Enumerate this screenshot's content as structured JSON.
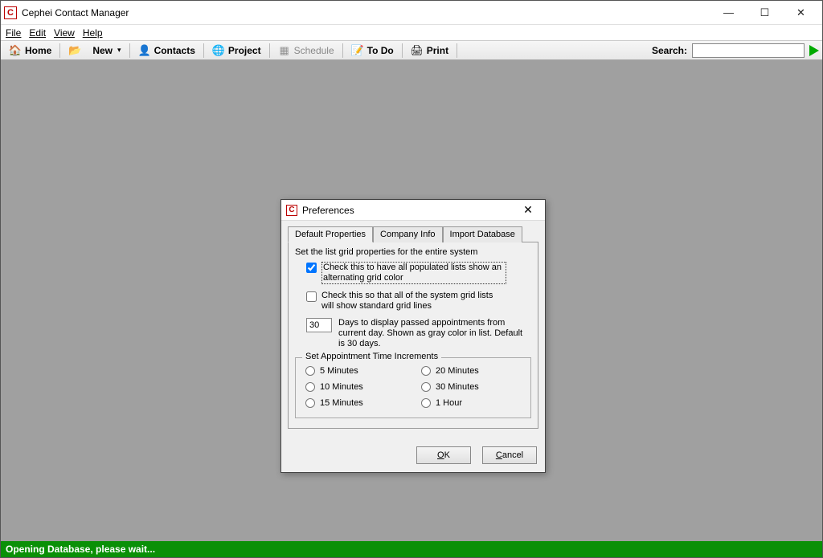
{
  "app": {
    "title": "Cephei Contact Manager",
    "icon_letter": "C"
  },
  "menu": {
    "file": "File",
    "edit": "Edit",
    "view": "View",
    "help": "Help"
  },
  "toolbar": {
    "home": "Home",
    "new": "New",
    "contacts": "Contacts",
    "project": "Project",
    "schedule": "Schedule",
    "todo": "To Do",
    "print": "Print",
    "search_label": "Search:",
    "search_value": ""
  },
  "status": {
    "text": "Opening Database, please wait..."
  },
  "dialog": {
    "title": "Preferences",
    "tabs": {
      "default_props": "Default Properties",
      "company_info": "Company Info",
      "import_db": "Import Database"
    },
    "panel_heading": "Set the list grid properties for the entire system",
    "check_alternating": {
      "label": "Check this to have all populated lists show an alternating grid color",
      "checked": true
    },
    "check_gridlines": {
      "label": "Check this so that all of the system grid lists will show standard grid lines",
      "checked": false
    },
    "days": {
      "value": "30",
      "label": "Days to display passed appointments from current day. Shown as gray color in list. Default is 30 days."
    },
    "increments": {
      "legend": "Set Appointment Time Increments",
      "options": [
        "5 Minutes",
        "20 Minutes",
        "10 Minutes",
        "30 Minutes",
        "15 Minutes",
        "1 Hour"
      ]
    },
    "buttons": {
      "ok": "OK",
      "cancel": "Cancel"
    }
  }
}
